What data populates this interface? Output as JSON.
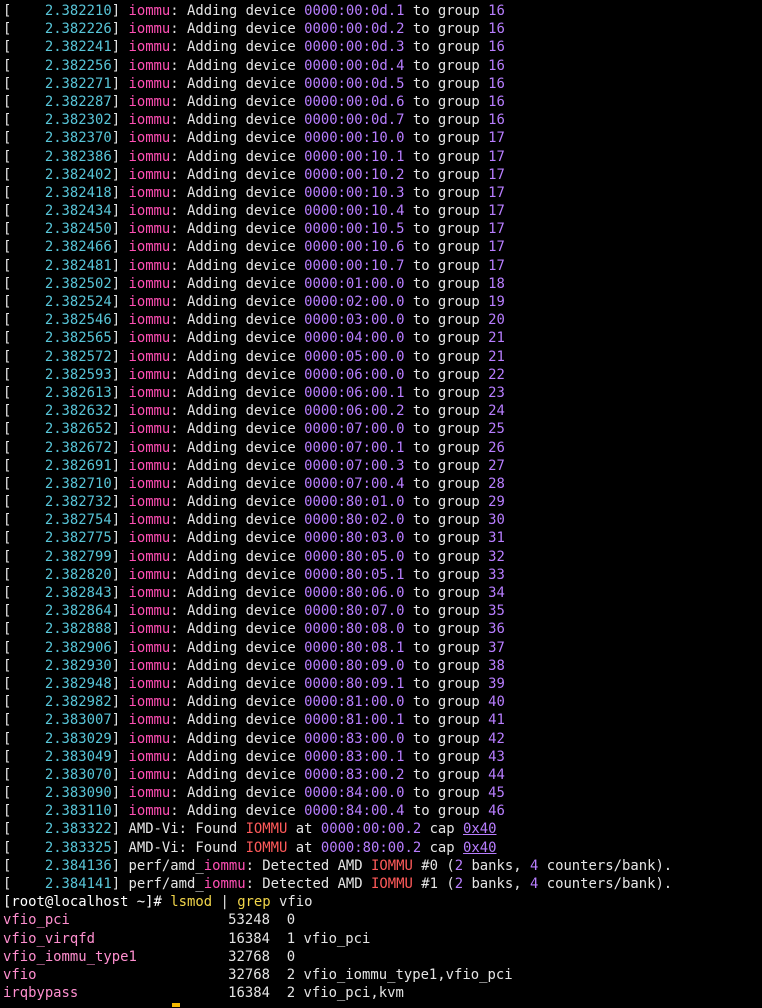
{
  "colors": {
    "background": "#000000",
    "timestamp": "#58c5d8",
    "subsystem": "#ff4fb4",
    "value": "#b87eff",
    "text": "#e5e5e5"
  },
  "iommu_lines": [
    {
      "ts": "2.382210",
      "dev": "0000:00:0d.1",
      "grp": "16"
    },
    {
      "ts": "2.382226",
      "dev": "0000:00:0d.2",
      "grp": "16"
    },
    {
      "ts": "2.382241",
      "dev": "0000:00:0d.3",
      "grp": "16"
    },
    {
      "ts": "2.382256",
      "dev": "0000:00:0d.4",
      "grp": "16"
    },
    {
      "ts": "2.382271",
      "dev": "0000:00:0d.5",
      "grp": "16"
    },
    {
      "ts": "2.382287",
      "dev": "0000:00:0d.6",
      "grp": "16"
    },
    {
      "ts": "2.382302",
      "dev": "0000:00:0d.7",
      "grp": "16"
    },
    {
      "ts": "2.382370",
      "dev": "0000:00:10.0",
      "grp": "17"
    },
    {
      "ts": "2.382386",
      "dev": "0000:00:10.1",
      "grp": "17"
    },
    {
      "ts": "2.382402",
      "dev": "0000:00:10.2",
      "grp": "17"
    },
    {
      "ts": "2.382418",
      "dev": "0000:00:10.3",
      "grp": "17"
    },
    {
      "ts": "2.382434",
      "dev": "0000:00:10.4",
      "grp": "17"
    },
    {
      "ts": "2.382450",
      "dev": "0000:00:10.5",
      "grp": "17"
    },
    {
      "ts": "2.382466",
      "dev": "0000:00:10.6",
      "grp": "17"
    },
    {
      "ts": "2.382481",
      "dev": "0000:00:10.7",
      "grp": "17"
    },
    {
      "ts": "2.382502",
      "dev": "0000:01:00.0",
      "grp": "18"
    },
    {
      "ts": "2.382524",
      "dev": "0000:02:00.0",
      "grp": "19"
    },
    {
      "ts": "2.382546",
      "dev": "0000:03:00.0",
      "grp": "20"
    },
    {
      "ts": "2.382565",
      "dev": "0000:04:00.0",
      "grp": "21"
    },
    {
      "ts": "2.382572",
      "dev": "0000:05:00.0",
      "grp": "21"
    },
    {
      "ts": "2.382593",
      "dev": "0000:06:00.0",
      "grp": "22"
    },
    {
      "ts": "2.382613",
      "dev": "0000:06:00.1",
      "grp": "23"
    },
    {
      "ts": "2.382632",
      "dev": "0000:06:00.2",
      "grp": "24"
    },
    {
      "ts": "2.382652",
      "dev": "0000:07:00.0",
      "grp": "25"
    },
    {
      "ts": "2.382672",
      "dev": "0000:07:00.1",
      "grp": "26"
    },
    {
      "ts": "2.382691",
      "dev": "0000:07:00.3",
      "grp": "27"
    },
    {
      "ts": "2.382710",
      "dev": "0000:07:00.4",
      "grp": "28"
    },
    {
      "ts": "2.382732",
      "dev": "0000:80:01.0",
      "grp": "29"
    },
    {
      "ts": "2.382754",
      "dev": "0000:80:02.0",
      "grp": "30"
    },
    {
      "ts": "2.382775",
      "dev": "0000:80:03.0",
      "grp": "31"
    },
    {
      "ts": "2.382799",
      "dev": "0000:80:05.0",
      "grp": "32"
    },
    {
      "ts": "2.382820",
      "dev": "0000:80:05.1",
      "grp": "33"
    },
    {
      "ts": "2.382843",
      "dev": "0000:80:06.0",
      "grp": "34"
    },
    {
      "ts": "2.382864",
      "dev": "0000:80:07.0",
      "grp": "35"
    },
    {
      "ts": "2.382888",
      "dev": "0000:80:08.0",
      "grp": "36"
    },
    {
      "ts": "2.382906",
      "dev": "0000:80:08.1",
      "grp": "37"
    },
    {
      "ts": "2.382930",
      "dev": "0000:80:09.0",
      "grp": "38"
    },
    {
      "ts": "2.382948",
      "dev": "0000:80:09.1",
      "grp": "39"
    },
    {
      "ts": "2.382982",
      "dev": "0000:81:00.0",
      "grp": "40"
    },
    {
      "ts": "2.383007",
      "dev": "0000:81:00.1",
      "grp": "41"
    },
    {
      "ts": "2.383029",
      "dev": "0000:83:00.0",
      "grp": "42"
    },
    {
      "ts": "2.383049",
      "dev": "0000:83:00.1",
      "grp": "43"
    },
    {
      "ts": "2.383070",
      "dev": "0000:83:00.2",
      "grp": "44"
    },
    {
      "ts": "2.383090",
      "dev": "0000:84:00.0",
      "grp": "45"
    },
    {
      "ts": "2.383110",
      "dev": "0000:84:00.4",
      "grp": "46"
    }
  ],
  "iommu_words": {
    "tag": "iommu",
    "action": ": Adding device ",
    "to": " to group "
  },
  "amdvi_lines": [
    {
      "ts": "2.383322",
      "addr": "0000:00:00.2",
      "cap": "0x40"
    },
    {
      "ts": "2.383325",
      "addr": "0000:80:00.2",
      "cap": "0x40"
    }
  ],
  "amdvi_words": {
    "prefix": "AMD-Vi: Found ",
    "iommu": "IOMMU",
    "at": " at ",
    "cap": " cap "
  },
  "perf_lines": [
    {
      "ts": "2.384136",
      "num": "#0",
      "banks": "2",
      "counters": "4"
    },
    {
      "ts": "2.384141",
      "num": "#1",
      "banks": "2",
      "counters": "4"
    }
  ],
  "perf_words": {
    "prefix": "perf/amd_",
    "iommu_lc": "iommu",
    "detected": ": Detected AMD ",
    "iommu": "IOMMU",
    "space": " ",
    "open": " (",
    "banks": " banks, ",
    "counters": " counters/bank)."
  },
  "prompt": {
    "text": "[root@localhost ~]# ",
    "cmd": "lsmod",
    "pipe": " | ",
    "grep": "grep",
    "arg": " vfio"
  },
  "lsmod": [
    {
      "name": "vfio_pci",
      "size": "53248",
      "used": "0",
      "by": ""
    },
    {
      "name": "vfio_virqfd",
      "size": "16384",
      "used": "1",
      "by": "vfio_pci"
    },
    {
      "name": "vfio_iommu_type1",
      "size": "32768",
      "used": "0",
      "by": ""
    },
    {
      "name": "vfio",
      "size": "32768",
      "used": "2",
      "by": "vfio_iommu_type1,vfio_pci"
    },
    {
      "name": "irqbypass",
      "size": "16384",
      "used": "2",
      "by": "vfio_pci,kvm"
    }
  ]
}
